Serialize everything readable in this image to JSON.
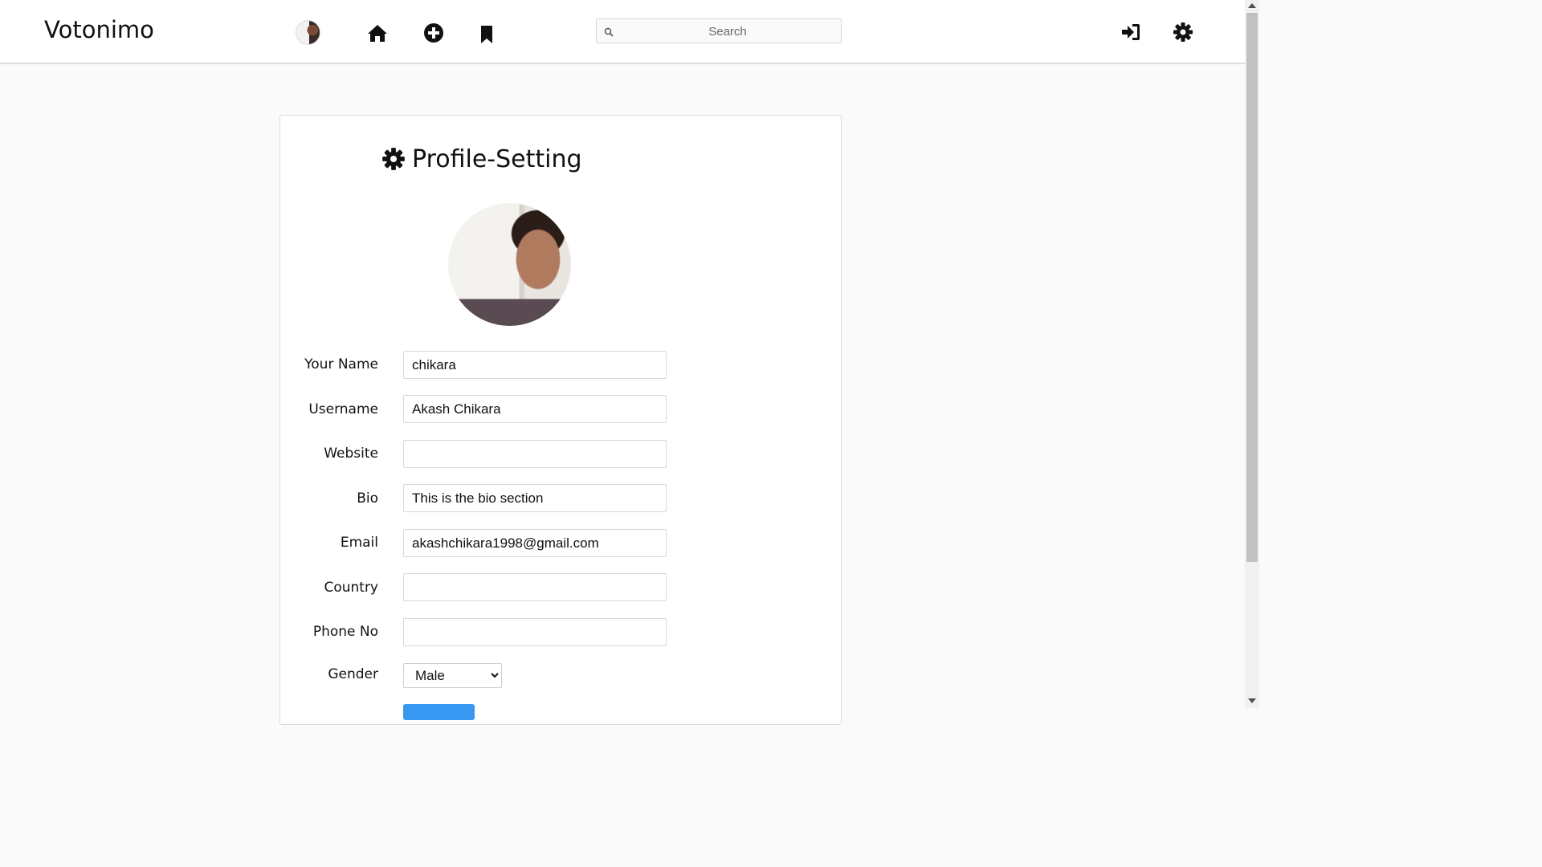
{
  "app": {
    "brand": "Votonimo"
  },
  "header": {
    "icons": [
      "home-icon",
      "add-post-icon",
      "bookmark-icon",
      "login-icon",
      "settings-icon"
    ],
    "search": {
      "placeholder": "Search",
      "value": ""
    }
  },
  "page": {
    "title": "Profile-Setting"
  },
  "form": {
    "name": {
      "label": "Your Name",
      "value": "chikara"
    },
    "username": {
      "label": "Username",
      "value": "Akash Chikara"
    },
    "website": {
      "label": "Website",
      "value": ""
    },
    "bio": {
      "label": "Bio",
      "value": "This is the bio section"
    },
    "email": {
      "label": "Email",
      "value": "akashchikara1998@gmail.com"
    },
    "country": {
      "label": "Country",
      "value": ""
    },
    "phone": {
      "label": "Phone No",
      "value": ""
    },
    "gender": {
      "label": "Gender",
      "selected": "Male"
    }
  },
  "colors": {
    "accent": "#3897f0",
    "navbar_bg": "#ffffff",
    "page_bg": "#fafafa"
  }
}
